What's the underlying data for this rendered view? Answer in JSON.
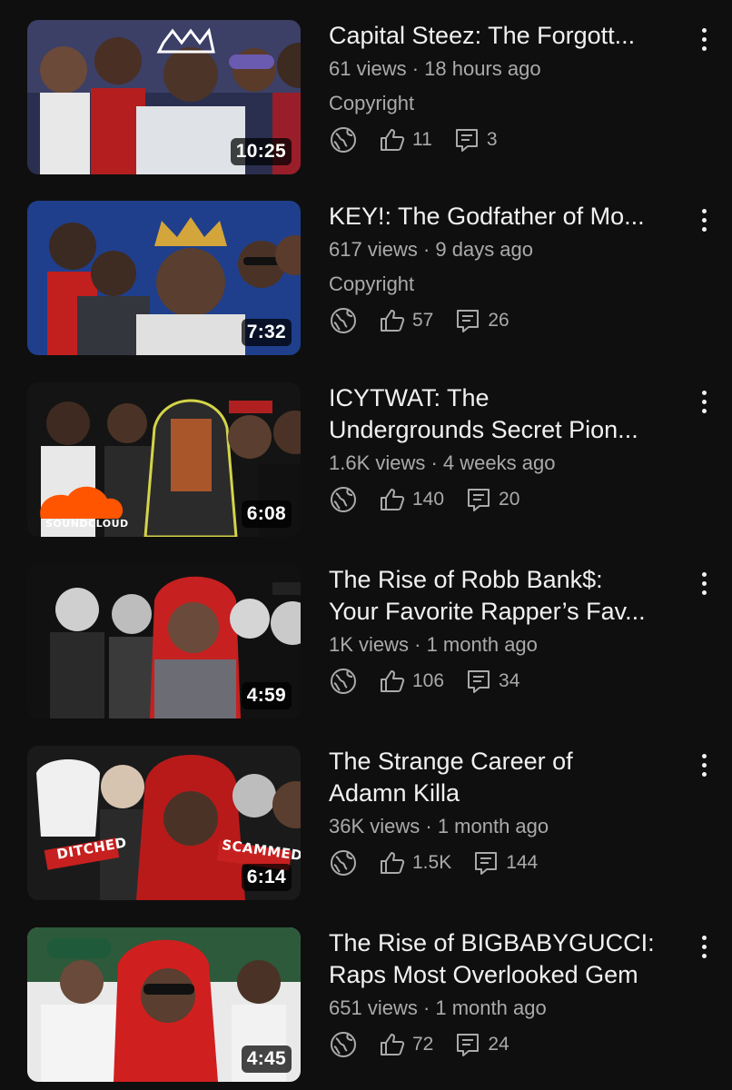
{
  "videos": [
    {
      "title": "Capital Steez: The Forgott...",
      "meta": "61 views · 18 hours ago",
      "tag": "Copyright",
      "duration": "10:25",
      "likes": "11",
      "comments": "3",
      "thumb_colors": [
        "#9c1f21",
        "#2a2f4f",
        "#e6e7ea"
      ]
    },
    {
      "title": "KEY!: The Godfather of Mo...",
      "meta": "617 views · 9 days ago",
      "tag": "Copyright",
      "duration": "7:32",
      "likes": "57",
      "comments": "26",
      "thumb_colors": [
        "#1f3f8c",
        "#c21f1f",
        "#d4a53a"
      ]
    },
    {
      "title": "ICYTWAT: The\nUndergrounds Secret Pion...",
      "meta": "1.6K views · 4 weeks ago",
      "tag": "",
      "duration": "6:08",
      "likes": "140",
      "comments": "20",
      "badge": "SOUNDCLOUD",
      "thumb_colors": [
        "#e0e0e0",
        "#1f1f1f",
        "#ff5500"
      ]
    },
    {
      "title": "The Rise of Robb Bank$:\nYour Favorite Rapper’s Fav...",
      "meta": "1K views · 1 month ago",
      "tag": "",
      "duration": "4:59",
      "likes": "106",
      "comments": "34",
      "thumb_colors": [
        "#111111",
        "#c62020",
        "#ffffff"
      ]
    },
    {
      "title": "The Strange Career of\nAdamn Killa",
      "meta": "36K views · 1 month ago",
      "tag": "",
      "duration": "6:14",
      "likes": "1.5K",
      "comments": "144",
      "badge": "DITCHED",
      "badge2": "SCAMMED",
      "thumb_colors": [
        "#1a1a1a",
        "#b81a1a",
        "#f0f0f0"
      ]
    },
    {
      "title": "The Rise of BIGBABYGUCCI:\nRaps Most Overlooked Gem",
      "meta": "651 views · 1 month ago",
      "tag": "",
      "duration": "4:45",
      "likes": "72",
      "comments": "24",
      "thumb_colors": [
        "#2c5a3a",
        "#d01f1f",
        "#f2f2f2"
      ]
    }
  ],
  "icons": {
    "visibility": "globe-icon",
    "likes": "thumbs-up-icon",
    "comments": "comment-icon",
    "menu": "more-vertical-icon"
  }
}
